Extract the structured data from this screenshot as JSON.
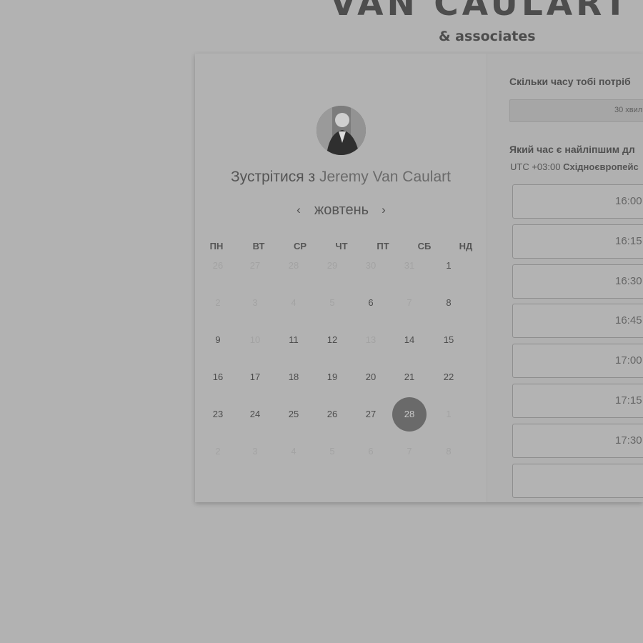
{
  "brand": {
    "name": "VAN CAULART",
    "subtitle": "& associates"
  },
  "left": {
    "meet_prefix": "Зустрітися з",
    "host_name": "Jeremy Van Caulart",
    "avatar_icon": "person-avatar",
    "prev_icon": "chevron-left-icon",
    "next_icon": "chevron-right-icon",
    "prev_symbol": "‹",
    "next_symbol": "›",
    "month": "жовтень",
    "weekdays": [
      "ПН",
      "ВТ",
      "СР",
      "ЧТ",
      "ПТ",
      "СБ",
      "НД"
    ],
    "weeks": [
      [
        {
          "d": "26",
          "muted": true
        },
        {
          "d": "27",
          "muted": true
        },
        {
          "d": "28",
          "muted": true
        },
        {
          "d": "29",
          "muted": true
        },
        {
          "d": "30",
          "muted": true
        },
        {
          "d": "31",
          "muted": true
        },
        {
          "d": "1",
          "muted": false
        }
      ],
      [
        {
          "d": "2",
          "muted": true
        },
        {
          "d": "3",
          "muted": true
        },
        {
          "d": "4",
          "muted": true
        },
        {
          "d": "5",
          "muted": true
        },
        {
          "d": "6",
          "muted": false
        },
        {
          "d": "7",
          "muted": true
        },
        {
          "d": "8",
          "muted": false
        }
      ],
      [
        {
          "d": "9",
          "muted": false
        },
        {
          "d": "10",
          "muted": true
        },
        {
          "d": "11",
          "muted": false
        },
        {
          "d": "12",
          "muted": false
        },
        {
          "d": "13",
          "muted": true
        },
        {
          "d": "14",
          "muted": false
        },
        {
          "d": "15",
          "muted": false
        }
      ],
      [
        {
          "d": "16",
          "muted": false
        },
        {
          "d": "17",
          "muted": false
        },
        {
          "d": "18",
          "muted": false
        },
        {
          "d": "19",
          "muted": false
        },
        {
          "d": "20",
          "muted": false
        },
        {
          "d": "21",
          "muted": false
        },
        {
          "d": "22",
          "muted": false
        }
      ],
      [
        {
          "d": "23",
          "muted": false
        },
        {
          "d": "24",
          "muted": false
        },
        {
          "d": "25",
          "muted": false
        },
        {
          "d": "26",
          "muted": false
        },
        {
          "d": "27",
          "muted": false
        },
        {
          "d": "28",
          "muted": false,
          "selected": true
        },
        {
          "d": "1",
          "muted": true
        }
      ],
      [
        {
          "d": "2",
          "muted": true
        },
        {
          "d": "3",
          "muted": true
        },
        {
          "d": "4",
          "muted": true
        },
        {
          "d": "5",
          "muted": true
        },
        {
          "d": "6",
          "muted": true
        },
        {
          "d": "7",
          "muted": true
        },
        {
          "d": "8",
          "muted": true
        }
      ]
    ]
  },
  "right": {
    "duration_question": "Скільки часу тобі потріб",
    "duration_value": "30 хвил",
    "time_question": "Який час є найліпшим дл",
    "tz_offset": "UTC +03:00",
    "tz_name": "Східноєвропейс",
    "slots": [
      "16:00",
      "16:15",
      "16:30",
      "16:45",
      "17:00",
      "17:15",
      "17:30",
      ""
    ]
  },
  "colors": {
    "page_bg": "#b2b2b2",
    "selected_day_bg": "#6a6a6a"
  }
}
